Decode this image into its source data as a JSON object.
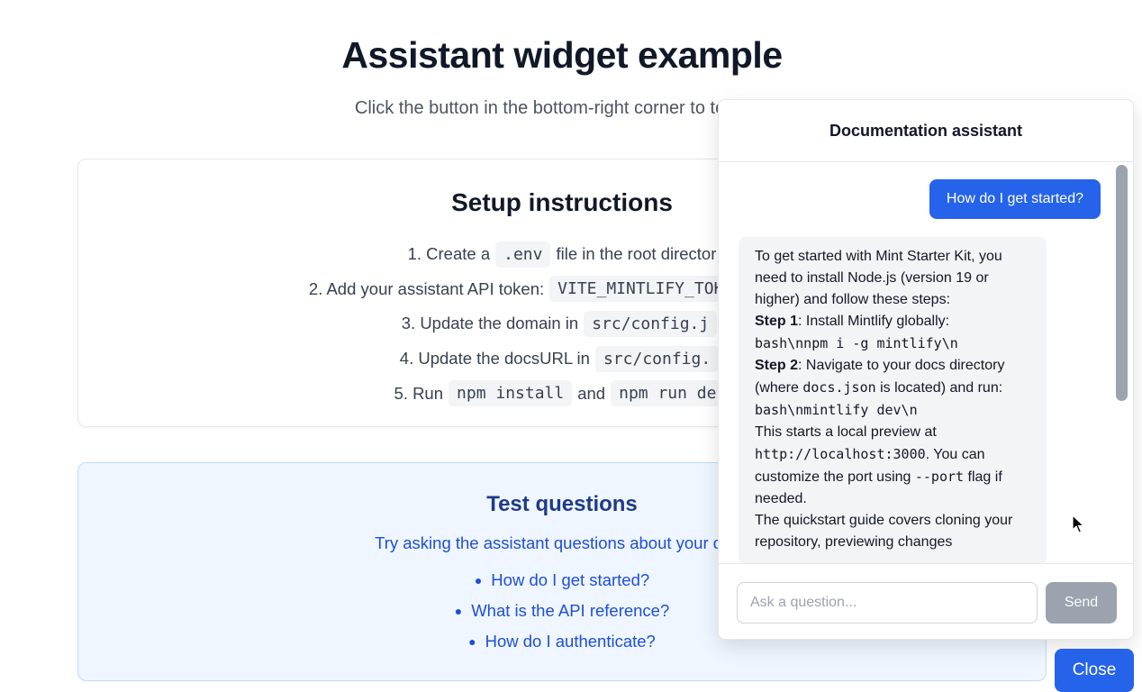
{
  "page": {
    "title": "Assistant widget example",
    "subtitle": "Click the button in the bottom-right corner to test the"
  },
  "setup": {
    "title": "Setup instructions",
    "steps": [
      {
        "before": "1. Create a",
        "code": ".env",
        "after": "file in the root director"
      },
      {
        "before": "2. Add your assistant API token:",
        "code": "VITE_MINTLIFY_TOKEN=mint_",
        "after": ""
      },
      {
        "before": "3. Update the domain in",
        "code": "src/config.j",
        "after": ""
      },
      {
        "before": "4. Update the docsURL in",
        "code": "src/config.",
        "after": ""
      },
      {
        "before": "5. Run",
        "code": "npm install",
        "middle": "and",
        "code2": "npm run de"
      }
    ]
  },
  "test": {
    "title": "Test questions",
    "description": "Try asking the assistant questions about your docu",
    "questions": [
      "How do I get started?",
      "What is the API reference?",
      "How do I authenticate?"
    ]
  },
  "assistant": {
    "title": "Documentation assistant",
    "user_message": "How do I get started?",
    "bot": {
      "p1": "To get started with Mint Starter Kit, you need to install Node.js (version 19 or higher) and follow these steps:",
      "step1_label": "Step 1",
      "step1_text": ": Install Mintlify globally:",
      "step1_code": "bash\\nnpm i -g mintlify\\n",
      "step2_label": "Step 2",
      "step2_text_a": ": Navigate to your docs directory (where",
      "step2_code_a": "docs.json",
      "step2_text_b": "is located) and run:",
      "step2_code_b": "bash\\nmintlify dev\\n",
      "p3_a": "This starts a local preview at",
      "p3_code_a": "http://localhost:3000",
      "p3_b": ". You can customize the port using",
      "p3_code_b": "--port",
      "p3_c": "flag if needed.",
      "p4": "The quickstart guide covers cloning your repository, previewing changes"
    },
    "input_placeholder": "Ask a question...",
    "send_label": "Send"
  },
  "close_label": "Close"
}
